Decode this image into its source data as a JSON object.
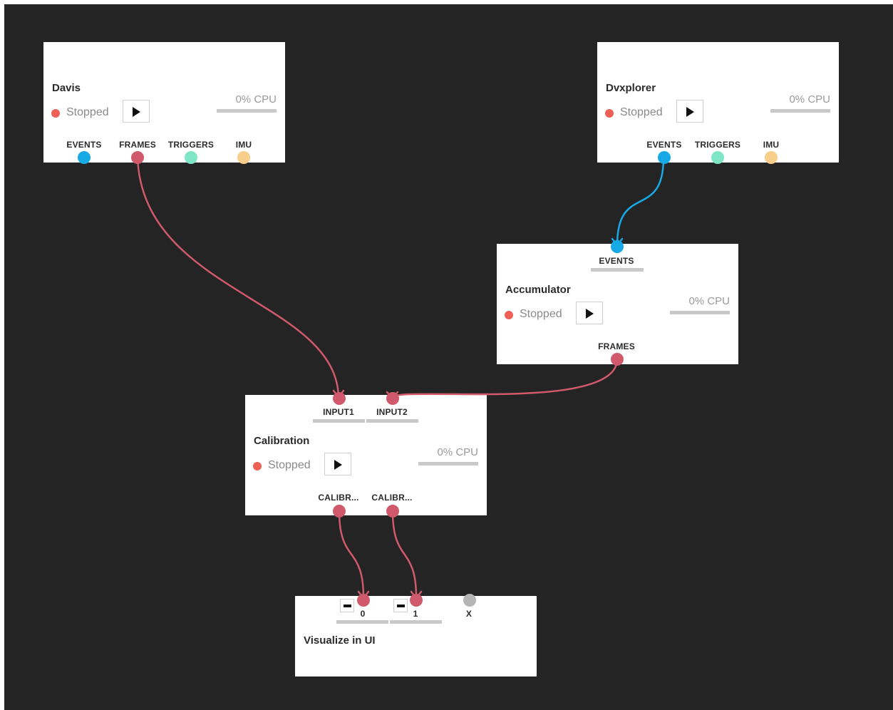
{
  "colors": {
    "background": "#242424",
    "events": "#16a9e6",
    "frames": "#d05a6c",
    "triggers": "#7ee6c4",
    "imu": "#f9cd8a",
    "inactive": "#b5b5b5",
    "status_stopped": "#ee5f55"
  },
  "nodes": {
    "davis": {
      "title": "Davis",
      "status": "Stopped",
      "cpu": "0% CPU",
      "outputs": [
        "EVENTS",
        "FRAMES",
        "TRIGGERS",
        "IMU"
      ]
    },
    "dvxplorer": {
      "title": "Dvxplorer",
      "status": "Stopped",
      "cpu": "0% CPU",
      "outputs": [
        "EVENTS",
        "TRIGGERS",
        "IMU"
      ]
    },
    "accumulator": {
      "title": "Accumulator",
      "status": "Stopped",
      "cpu": "0% CPU",
      "inputs": [
        "EVENTS"
      ],
      "outputs": [
        "FRAMES"
      ]
    },
    "calibration": {
      "title": "Calibration",
      "status": "Stopped",
      "cpu": "0% CPU",
      "inputs": [
        "INPUT1",
        "INPUT2"
      ],
      "outputs": [
        "CALIBR...",
        "CALIBR..."
      ]
    },
    "visualize": {
      "title": "Visualize in UI",
      "inputs": [
        "0",
        "1",
        "X"
      ]
    }
  },
  "icons": {
    "play": "play-icon",
    "remove": "minus-icon",
    "status": "status-dot-icon"
  }
}
